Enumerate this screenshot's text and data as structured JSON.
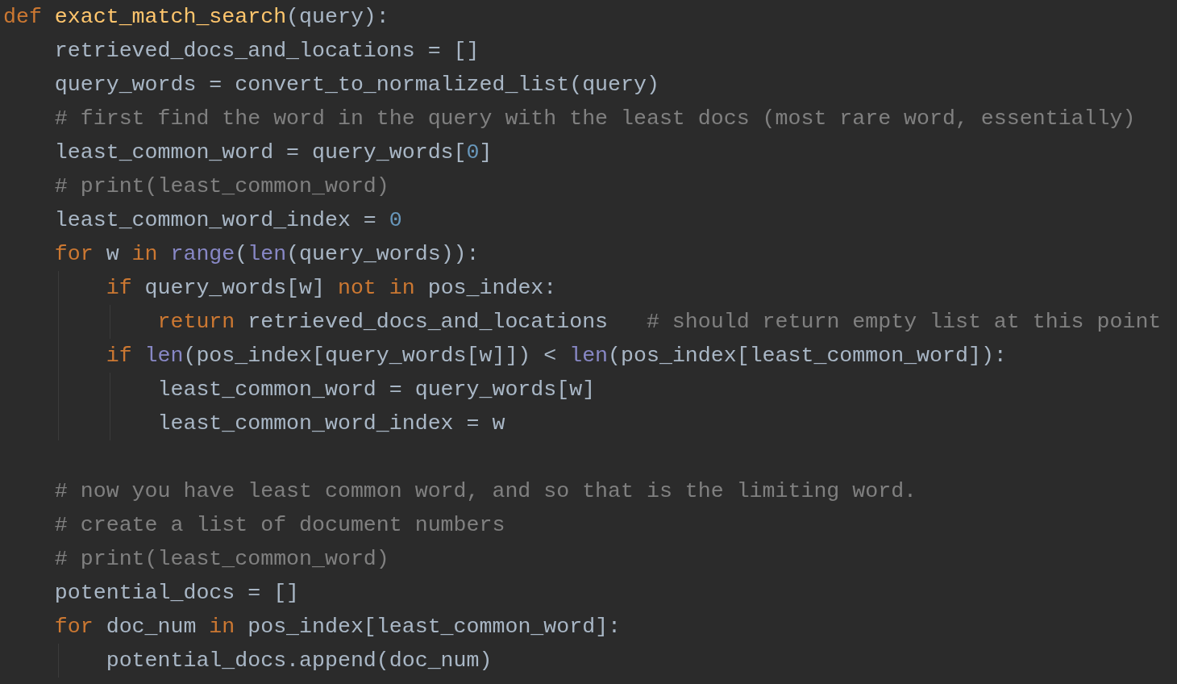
{
  "editor": {
    "lines": [
      {
        "kind": "code",
        "tokens": [
          {
            "kind": "keyword",
            "text": "def"
          },
          {
            "kind": "function",
            "text": " exact_match_search"
          },
          {
            "kind": "plain",
            "text": "(query):"
          }
        ]
      },
      {
        "kind": "code",
        "tokens": [
          {
            "kind": "plain",
            "text": "    retrieved_docs_and_locations = []"
          }
        ]
      },
      {
        "kind": "code",
        "tokens": [
          {
            "kind": "plain",
            "text": "    query_words = convert_to_normalized_list(query)"
          }
        ]
      },
      {
        "kind": "code",
        "tokens": [
          {
            "kind": "comment",
            "text": "    # first find the word in the query with the least docs (most rare word, essentially)"
          }
        ]
      },
      {
        "kind": "code",
        "tokens": [
          {
            "kind": "plain",
            "text": "    least_common_word = query_words["
          },
          {
            "kind": "number",
            "text": "0"
          },
          {
            "kind": "plain",
            "text": "]"
          }
        ]
      },
      {
        "kind": "code",
        "tokens": [
          {
            "kind": "comment",
            "text": "    # print(least_common_word)"
          }
        ]
      },
      {
        "kind": "code",
        "tokens": [
          {
            "kind": "plain",
            "text": "    least_common_word_index = "
          },
          {
            "kind": "number",
            "text": "0"
          }
        ]
      },
      {
        "kind": "code",
        "tokens": [
          {
            "kind": "keyword",
            "text": "    for"
          },
          {
            "kind": "plain",
            "text": " w "
          },
          {
            "kind": "keyword",
            "text": "in"
          },
          {
            "kind": "builtin",
            "text": " range"
          },
          {
            "kind": "plain",
            "text": "("
          },
          {
            "kind": "builtin",
            "text": "len"
          },
          {
            "kind": "plain",
            "text": "(query_words)):"
          }
        ]
      },
      {
        "kind": "code",
        "tokens": [
          {
            "kind": "keyword",
            "text": "        if"
          },
          {
            "kind": "plain",
            "text": " query_words[w] "
          },
          {
            "kind": "keyword",
            "text": "not"
          },
          {
            "kind": "keyword",
            "text": " in"
          },
          {
            "kind": "plain",
            "text": " pos_index:"
          }
        ]
      },
      {
        "kind": "code",
        "tokens": [
          {
            "kind": "keyword",
            "text": "            return"
          },
          {
            "kind": "plain",
            "text": " retrieved_docs_and_locations"
          },
          {
            "kind": "comment",
            "text": "   # should return empty list at this point"
          }
        ]
      },
      {
        "kind": "code",
        "tokens": [
          {
            "kind": "keyword",
            "text": "        if"
          },
          {
            "kind": "builtin",
            "text": " len"
          },
          {
            "kind": "plain",
            "text": "(pos_index[query_words[w]]) < "
          },
          {
            "kind": "builtin",
            "text": "len"
          },
          {
            "kind": "plain",
            "text": "(pos_index[least_common_word]):"
          }
        ]
      },
      {
        "kind": "code",
        "tokens": [
          {
            "kind": "plain",
            "text": "            least_common_word = query_words[w]"
          }
        ]
      },
      {
        "kind": "code",
        "tokens": [
          {
            "kind": "plain",
            "text": "            least_common_word_index = w"
          }
        ]
      },
      {
        "kind": "blank"
      },
      {
        "kind": "code",
        "tokens": [
          {
            "kind": "comment",
            "text": "    # now you have least common word, and so that is the limiting word."
          }
        ]
      },
      {
        "kind": "code",
        "tokens": [
          {
            "kind": "comment",
            "text": "    # create a list of document numbers"
          }
        ]
      },
      {
        "kind": "code",
        "tokens": [
          {
            "kind": "comment",
            "text": "    # print(least_common_word)"
          }
        ]
      },
      {
        "kind": "code",
        "tokens": [
          {
            "kind": "plain",
            "text": "    potential_docs = []"
          }
        ]
      },
      {
        "kind": "code",
        "tokens": [
          {
            "kind": "keyword",
            "text": "    for"
          },
          {
            "kind": "plain",
            "text": " doc_num "
          },
          {
            "kind": "keyword",
            "text": "in"
          },
          {
            "kind": "plain",
            "text": " pos_index[least_common_word]:"
          }
        ]
      },
      {
        "kind": "code",
        "tokens": [
          {
            "kind": "plain",
            "text": "        potential_docs.append(doc_num)"
          }
        ]
      }
    ]
  }
}
